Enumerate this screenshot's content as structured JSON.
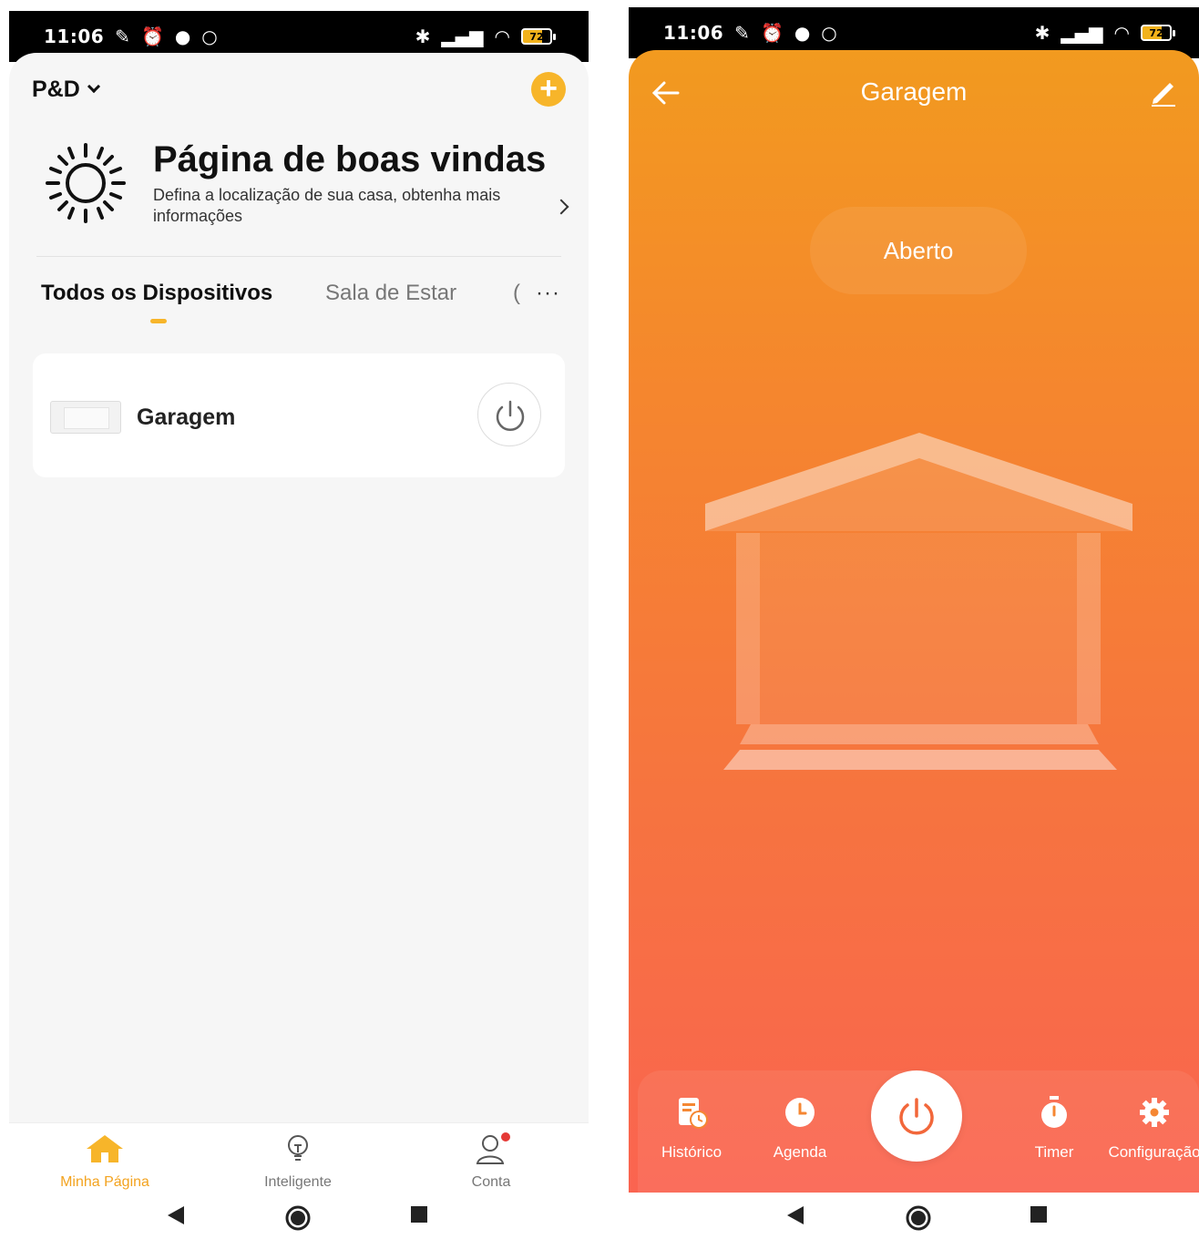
{
  "left": {
    "status": {
      "time": "11:06",
      "battery": "72"
    },
    "home_name": "P&D",
    "welcome": {
      "title": "Página de boas vindas",
      "subtitle": "Defina a localização de sua casa, obtenha mais informações"
    },
    "tabs": [
      {
        "label": "Todos os Dispositivos"
      },
      {
        "label": "Sala de Estar"
      },
      {
        "label": "("
      }
    ],
    "tab_more": "···",
    "devices": [
      {
        "name": "Garagem"
      }
    ],
    "nav": [
      {
        "label": "Minha Página"
      },
      {
        "label": "Inteligente"
      },
      {
        "label": "Conta"
      }
    ]
  },
  "right": {
    "status": {
      "time": "11:06",
      "battery": "72"
    },
    "title": "Garagem",
    "state": "Aberto",
    "controls": [
      {
        "label": "Histórico"
      },
      {
        "label": "Agenda"
      },
      {
        "label": "Timer"
      },
      {
        "label": "Configuração"
      }
    ]
  },
  "colors": {
    "accent": "#f7b52a",
    "gradient_top": "#f29a1f",
    "gradient_bottom": "#fa6450",
    "power_icon": "#f2673a"
  }
}
